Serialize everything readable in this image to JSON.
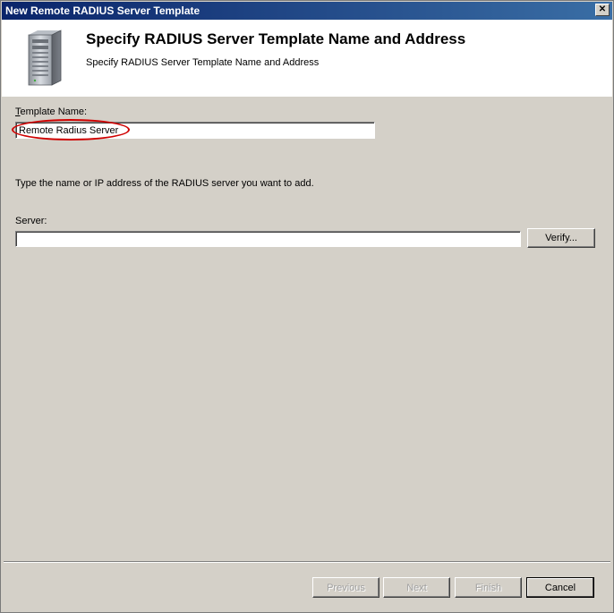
{
  "window": {
    "title": "New Remote RADIUS Server Template",
    "close_glyph": "✕"
  },
  "header": {
    "title": "Specify RADIUS Server Template Name and Address",
    "subtitle": "Specify RADIUS Server Template Name and Address"
  },
  "form": {
    "template_name_label_accel": "T",
    "template_name_label_rest": "emplate Name:",
    "template_name_value": "Remote Radius Server",
    "instructions": "Type the name or IP address of the RADIUS server you want to add.",
    "server_label": "Server:",
    "server_value": "",
    "verify_label": "Verify..."
  },
  "footer": {
    "previous_label": "Previous",
    "next_label": "Next",
    "finish_label": "Finish",
    "cancel_label": "Cancel"
  },
  "colors": {
    "highlight": "#d00000",
    "titlebar": "#0a246a"
  }
}
